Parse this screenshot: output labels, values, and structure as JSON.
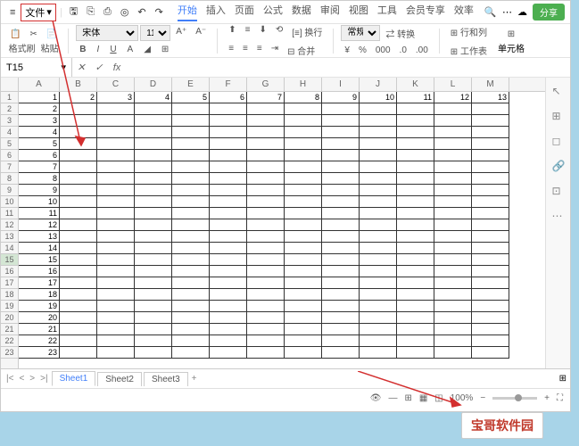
{
  "menubar": {
    "file_label": "文件",
    "tabs": [
      "开始",
      "插入",
      "页面",
      "公式",
      "数据",
      "审阅",
      "视图",
      "工具",
      "会员专享",
      "效率"
    ],
    "active_tab": 0,
    "share_label": "分享"
  },
  "ribbon": {
    "format_painter": "格式刷",
    "paste": "粘贴",
    "font_name": "宋体",
    "font_size": "11",
    "wrap": "换行",
    "general": "常规",
    "conditional": "转换",
    "rows_cols": "行和列",
    "worksheet": "工作表",
    "cell_format": "单元格",
    "merge": "合并"
  },
  "namebox": {
    "ref": "T15",
    "fx": "fx"
  },
  "columns": [
    "A",
    "B",
    "C",
    "D",
    "E",
    "F",
    "G",
    "H",
    "I",
    "J",
    "K",
    "L",
    "M"
  ],
  "row_count": 23,
  "selected_row": 15,
  "data_row1": [
    "1",
    "2",
    "3",
    "4",
    "5",
    "6",
    "7",
    "8",
    "9",
    "10",
    "11",
    "12",
    "13"
  ],
  "colA_values": [
    "1",
    "2",
    "3",
    "4",
    "5",
    "6",
    "7",
    "8",
    "9",
    "10",
    "11",
    "12",
    "13",
    "14",
    "15",
    "16",
    "17",
    "18",
    "19",
    "20",
    "21",
    "22",
    "23"
  ],
  "sheets": {
    "names": [
      "Sheet1",
      "Sheet2",
      "Sheet3"
    ],
    "active": 0,
    "add": "+"
  },
  "statusbar": {
    "zoom": "100%"
  },
  "watermark": "宝哥软件园"
}
